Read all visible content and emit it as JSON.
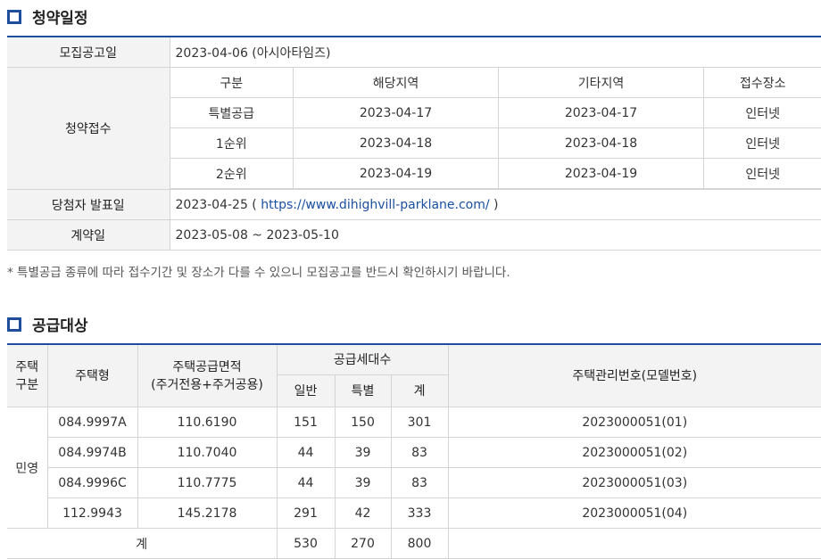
{
  "schedule_section": {
    "title": "청약일정",
    "announce_label": "모집공고일",
    "announce_value": "2023-04-06 (아시아타임즈)",
    "apply_label": "청약접수",
    "apply_headers": [
      "구분",
      "해당지역",
      "기타지역",
      "접수장소"
    ],
    "apply_rows": [
      [
        "특별공급",
        "2023-04-17",
        "2023-04-17",
        "인터넷"
      ],
      [
        "1순위",
        "2023-04-18",
        "2023-04-18",
        "인터넷"
      ],
      [
        "2순위",
        "2023-04-19",
        "2023-04-19",
        "인터넷"
      ]
    ],
    "winner_label": "당첨자 발표일",
    "winner_date": "2023-04-25 (",
    "winner_link": "https://www.dihighvill-parklane.com/",
    "winner_close": ")",
    "contract_label": "계약일",
    "contract_value": "2023-05-08 ~ 2023-05-10"
  },
  "note": "* 특별공급 종류에 따라 접수기간 및 장소가 다를 수 있으니 모집공고를 반드시 확인하시기 바랍니다.",
  "supply_section": {
    "title": "공급대상",
    "headers": {
      "category": "주택\n구분",
      "type": "주택형",
      "area": "주택공급면적\n(주거전용+주거공용)",
      "units": "공급세대수",
      "general": "일반",
      "special": "특별",
      "total": "계",
      "mgmt_no": "주택관리번호(모델번호)"
    },
    "category_value": "민영",
    "rows": [
      {
        "type": "084.9997A",
        "area": "110.6190",
        "general": "151",
        "special": "150",
        "total": "301",
        "mgmt_no": "2023000051(01)"
      },
      {
        "type": "084.9974B",
        "area": "110.7040",
        "general": "44",
        "special": "39",
        "total": "83",
        "mgmt_no": "2023000051(02)"
      },
      {
        "type": "084.9996C",
        "area": "110.7775",
        "general": "44",
        "special": "39",
        "total": "83",
        "mgmt_no": "2023000051(03)"
      },
      {
        "type": "112.9943",
        "area": "145.2178",
        "general": "291",
        "special": "42",
        "total": "333",
        "mgmt_no": "2023000051(04)"
      }
    ],
    "sum_label": "계",
    "sum_general": "530",
    "sum_special": "270",
    "sum_total": "800"
  }
}
